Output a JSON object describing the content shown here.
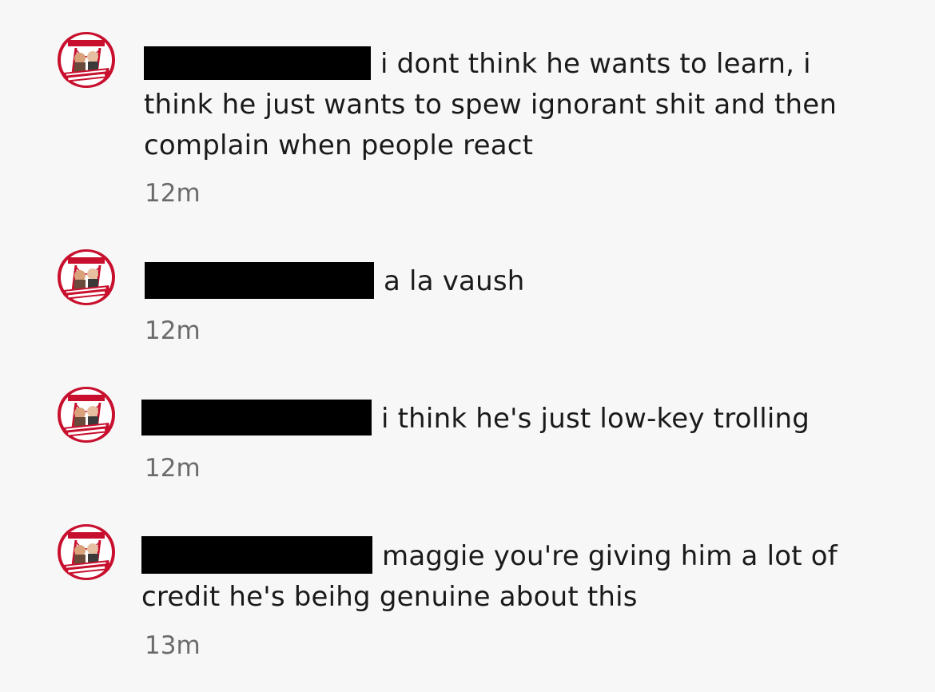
{
  "comments": [
    {
      "text": "i dont think he wants to learn, i think he just wants to spew ignorant shit and then complain when people react",
      "time": "12m",
      "avatar_icon": "san-fran-podcast-avatar-icon"
    },
    {
      "text": "a la vaush",
      "time": "12m",
      "avatar_icon": "san-fran-podcast-avatar-icon"
    },
    {
      "text": "i think he's just low-key trolling",
      "time": "12m",
      "avatar_icon": "san-fran-podcast-avatar-icon"
    },
    {
      "text": "maggie you're giving him a lot of credit he's beihg genuine about this",
      "time": "13m",
      "avatar_icon": "san-fran-podcast-avatar-icon"
    }
  ],
  "avatar_lettering": "DON'T CALL IT SAN FRAN",
  "colors": {
    "background": "#f7f7f7",
    "text": "#1a1a1a",
    "timestamp": "#6b6b6b",
    "avatar_red": "#c8102e",
    "redaction": "#000000"
  }
}
